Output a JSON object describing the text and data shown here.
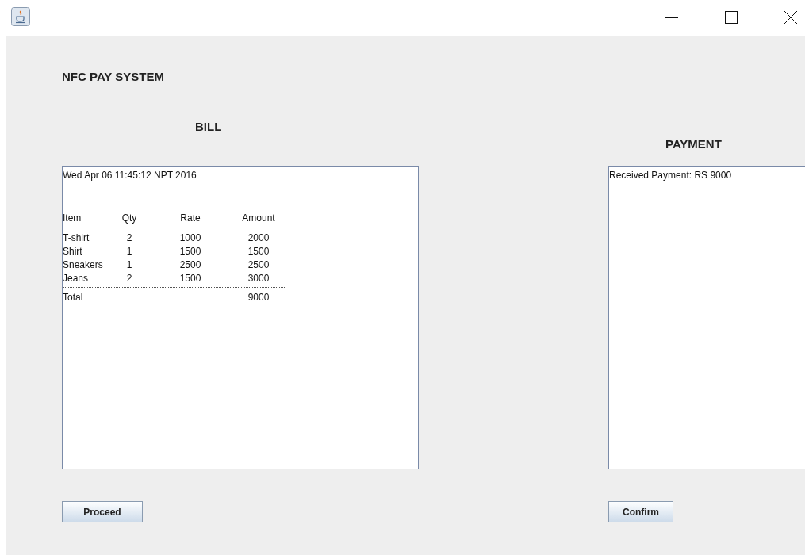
{
  "app_title": "NFC PAY SYSTEM",
  "bill": {
    "heading": "BILL",
    "timestamp": "Wed Apr 06 11:45:12 NPT 2016",
    "columns": [
      "Item",
      "Qty",
      "Rate",
      "Amount"
    ],
    "rows": [
      [
        "T-shirt",
        "2",
        "1000",
        "2000"
      ],
      [
        "Shirt",
        "1",
        "1500",
        "1500"
      ],
      [
        "Sneakers",
        "1",
        "2500",
        "2500"
      ],
      [
        "Jeans",
        "2",
        "1500",
        "3000"
      ]
    ],
    "total_label": "Total",
    "total": "9000",
    "button": "Proceed"
  },
  "payment": {
    "heading": "PAYMENT",
    "message": "Received Payment: RS 9000",
    "button": "Confirm"
  }
}
